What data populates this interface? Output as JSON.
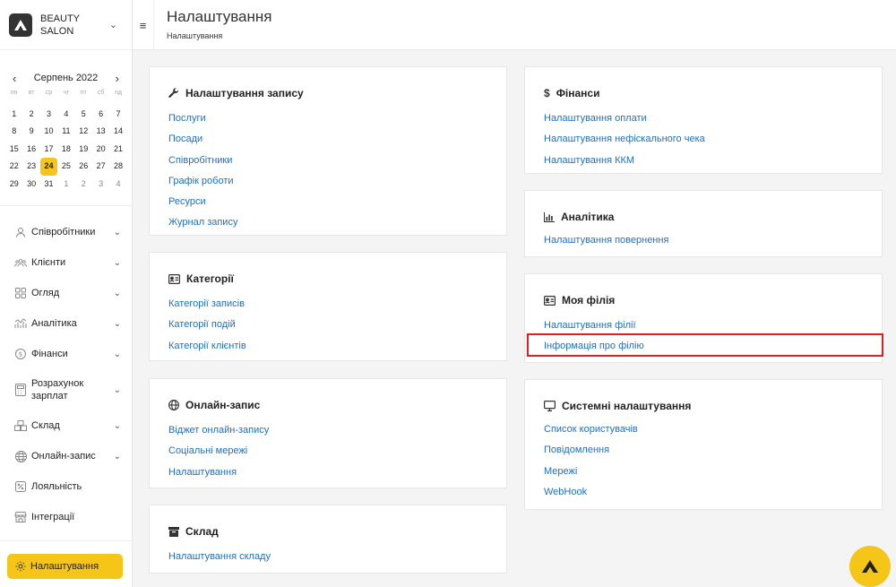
{
  "brand": {
    "name": "BEAUTY SALON"
  },
  "calendar": {
    "month": "Серпень 2022",
    "weekdays": [
      "пн",
      "вт",
      "ср",
      "чт",
      "пт",
      "сб",
      "нд"
    ],
    "weeks": [
      [
        "1",
        "2",
        "3",
        "4",
        "5",
        "6",
        "7"
      ],
      [
        "8",
        "9",
        "10",
        "11",
        "12",
        "13",
        "14"
      ],
      [
        "15",
        "16",
        "17",
        "18",
        "19",
        "20",
        "21"
      ],
      [
        "22",
        "23",
        "24",
        "25",
        "26",
        "27",
        "28"
      ],
      [
        "29",
        "30",
        "31",
        "1",
        "2",
        "3",
        "4"
      ]
    ],
    "today": "24"
  },
  "sidebar": {
    "items": [
      {
        "label": "Співробітники",
        "icon": "user-icon"
      },
      {
        "label": "Клієнти",
        "icon": "clients-icon"
      },
      {
        "label": "Огляд",
        "icon": "grid-icon"
      },
      {
        "label": "Аналітика",
        "icon": "analytics-icon"
      },
      {
        "label": "Фінанси",
        "icon": "dollar-icon"
      },
      {
        "label": "Розрахунок зарплат",
        "icon": "calculator-icon"
      },
      {
        "label": "Склад",
        "icon": "warehouse-icon"
      },
      {
        "label": "Онлайн-запис",
        "icon": "globe-icon"
      },
      {
        "label": "Лояльність",
        "icon": "percent-icon"
      },
      {
        "label": "Інтеграції",
        "icon": "store-icon"
      }
    ],
    "settings_label": "Налаштування"
  },
  "header": {
    "title": "Налаштування",
    "breadcrumb": "Налаштування"
  },
  "cards": {
    "booking": {
      "title": "Налаштування запису",
      "links": [
        "Послуги",
        "Посади",
        "Співробітники",
        "Графік роботи",
        "Ресурси",
        "Журнал запису"
      ]
    },
    "categories": {
      "title": "Категорії",
      "links": [
        "Категорії записів",
        "Категорії подій",
        "Категорії клієнтів"
      ]
    },
    "online": {
      "title": "Онлайн-запис",
      "links": [
        "Віджет онлайн-запису",
        "Соціальні мережі",
        "Налаштування"
      ]
    },
    "warehouse": {
      "title": "Склад",
      "links": [
        "Налаштування складу"
      ]
    },
    "finance": {
      "title": "Фінанси",
      "links": [
        "Налаштування оплати",
        "Налаштування нефіскального чека",
        "Налаштування ККМ"
      ]
    },
    "analytics": {
      "title": "Аналітика",
      "links": [
        "Налаштування повернення"
      ]
    },
    "branch": {
      "title": "Моя філія",
      "links": [
        "Налаштування філії",
        "Інформація про філію"
      ]
    },
    "system": {
      "title": "Системні налаштування",
      "links": [
        "Список користувачів",
        "Повідомлення",
        "Мережі",
        "WebHook"
      ]
    }
  },
  "colors": {
    "accent": "#f5c518",
    "link": "#1e6fc2",
    "highlight": "#e02020"
  }
}
